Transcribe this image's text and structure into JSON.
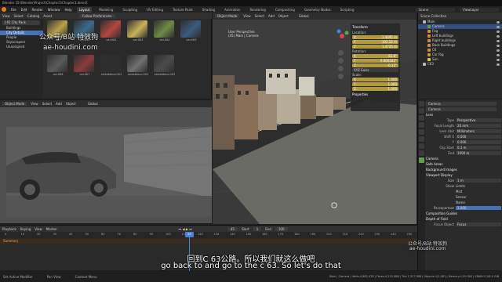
{
  "window": {
    "title": "Blender [D:\\Blender\\Project\\Chapter3\\Chapter3.blend]"
  },
  "menubar": {
    "menus": [
      "File",
      "Edit",
      "Render",
      "Window",
      "Help"
    ],
    "workspaces": [
      "Layout",
      "Modeling",
      "Sculpting",
      "UV Editing",
      "Texture Paint",
      "Shading",
      "Animation",
      "Rendering",
      "Compositing",
      "Geometry Nodes",
      "Scripting"
    ],
    "active_workspace": "Layout",
    "scene": "Scene",
    "view_layer": "ViewLayer"
  },
  "asset_browser": {
    "header": [
      "View",
      "Select",
      "Catalog",
      "Asset"
    ],
    "prefs_button": "Follow Preferences",
    "library": "[-R] City Pack",
    "catalogs": [
      "Buildings",
      "City Details",
      "People",
      "Skyscrapers",
      "Unassigned"
    ],
    "selected_catalog": "City Details",
    "assets": [
      {
        "name": "car",
        "color": "#b8a24a"
      },
      {
        "name": "car.001",
        "color": "#3d6a8a"
      },
      {
        "name": "car.002",
        "color": "#b3473f"
      },
      {
        "name": "car.003",
        "color": "#c9b25a"
      },
      {
        "name": "car.004",
        "color": "#6f8a45"
      },
      {
        "name": "car.005",
        "color": "#3c5a7d"
      },
      {
        "name": "car.006",
        "color": "#5a5a5a"
      },
      {
        "name": "car.007",
        "color": "#8a3b3b"
      },
      {
        "name": "streetdeco.001",
        "color": "#2e2e2e"
      },
      {
        "name": "streetdeco.002",
        "color": "#707070"
      },
      {
        "name": "streetdeco.003",
        "color": "#4a4a4a"
      }
    ]
  },
  "camera_view": {
    "header": [
      "Object Mode",
      "View",
      "Select",
      "Add",
      "Object",
      "Global"
    ]
  },
  "viewport": {
    "header": [
      "Object Mode",
      "View",
      "Select",
      "Add",
      "Object",
      "Global"
    ],
    "perspective": "User Perspective",
    "collection": "(45) Main | Camera"
  },
  "transform_panel": {
    "title": "Transform",
    "location_label": "Location:",
    "location": [
      [
        "X",
        "1.4695 m"
      ],
      [
        "Y",
        "-102.12 m"
      ],
      [
        "Z",
        "1.4725 m"
      ]
    ],
    "rotation_label": "Rotation:",
    "rotation": [
      [
        "X",
        "82.8°"
      ],
      [
        "Y",
        "0.000182°"
      ],
      [
        "Z",
        "-0.12°"
      ]
    ],
    "rotation_mode": "XYZ Euler",
    "scale_label": "Scale:",
    "scale": [
      [
        "X",
        "1.000"
      ],
      [
        "Y",
        "1.000"
      ],
      [
        "Z",
        "1.000"
      ]
    ],
    "properties_label": "Properties"
  },
  "outliner": {
    "title": "Scene Collection",
    "items": [
      {
        "name": "Main",
        "indent": 1,
        "selected": false,
        "color": "#b8b8b8"
      },
      {
        "name": "Camera",
        "indent": 2,
        "selected": true,
        "color": "#5fa14a"
      },
      {
        "name": "Fog",
        "indent": 2,
        "selected": false,
        "color": "#d48b3a"
      },
      {
        "name": "Left buildings",
        "indent": 2,
        "selected": false,
        "color": "#d48b3a"
      },
      {
        "name": "Right buildings",
        "indent": 2,
        "selected": false,
        "color": "#d48b3a"
      },
      {
        "name": "Back Buildings",
        "indent": 2,
        "selected": false,
        "color": "#d48b3a"
      },
      {
        "name": "C6",
        "indent": 2,
        "selected": false,
        "color": "#d48b3a"
      },
      {
        "name": "Car Rig",
        "indent": 2,
        "selected": false,
        "color": "#d48b3a"
      },
      {
        "name": "Sun",
        "indent": 2,
        "selected": false,
        "color": "#d4c84a"
      },
      {
        "name": "C63",
        "indent": 1,
        "selected": false,
        "color": "#b8b8b8"
      }
    ]
  },
  "properties": {
    "object": "Camera",
    "data": "Camera",
    "lens_section": "Lens",
    "type_label": "Type",
    "type": "Perspective",
    "focal_label": "Focal Length",
    "focal": "20 mm",
    "lens_unit_label": "Lens Unit",
    "lens_unit": "Millimeters",
    "shift_x_label": "Shift X",
    "shift_x": "0.000",
    "shift_y_label": "Y",
    "shift_y": "0.000",
    "clip_start_label": "Clip Start",
    "clip_start": "0.1 m",
    "clip_end_label": "End",
    "clip_end": "1000 m",
    "sections": [
      "Camera",
      "Safe Areas",
      "Background Images",
      "Viewport Display"
    ],
    "size_label": "Size",
    "size": "1 m",
    "show_label": "Show",
    "show_options": [
      "Limits",
      "Mist",
      "Sensor",
      "Name"
    ],
    "passepartout_label": "Passepartout",
    "passepartout": "1.000",
    "extra": [
      "Composition Guides",
      "Depth of Field"
    ],
    "focus_label": "Focus Object",
    "focus": "Focus"
  },
  "timeline": {
    "header": [
      "Playback",
      "Keying",
      "View",
      "Marker"
    ],
    "summary": "Summary",
    "current_frame": "45",
    "start_label": "Start",
    "start": "1",
    "end_label": "End",
    "end": "100",
    "ticks": [
      "0",
      "10",
      "20",
      "30",
      "40",
      "50",
      "60",
      "70",
      "80",
      "90",
      "100",
      "110",
      "120",
      "130",
      "140",
      "150",
      "160",
      "170",
      "180",
      "190",
      "200",
      "210",
      "220",
      "230",
      "240",
      "250"
    ]
  },
  "statusbar": {
    "items": [
      "Set Active Modifier",
      "Pan View",
      "Context Menu"
    ],
    "stats": "Main | Camera | Verts:4,882,478 | Faces:4,210,088 | Tris:7,317,988 | Objects:1/1,081 | Memory:1.59 GiB | VRAM:5.1/8.0 GiB"
  },
  "overlays": {
    "subtitle_cn": "回到C 63公路。所以我们就这么做吧",
    "subtitle_en": "go back to and go to the c 63. So let's do that",
    "watermark_top": "公众号/B站 特效狗",
    "watermark_url": "ae-houdini.com",
    "watermark_bottom": "公众号/B站 特效狗",
    "watermark_bottom_url": "ae-houdini.com"
  }
}
